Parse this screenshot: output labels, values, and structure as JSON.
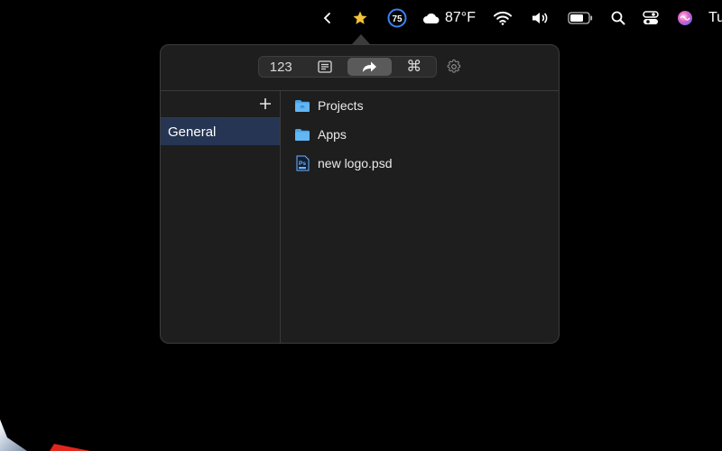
{
  "menubar": {
    "weather_temp": "87°F",
    "badge_number": "75",
    "clock_partial": "Tu",
    "icons": [
      "chevron-left-icon",
      "star-icon",
      "badge-icon",
      "cloud-icon",
      "wifi-icon",
      "volume-icon",
      "battery-icon",
      "search-icon",
      "control-center-icon",
      "siri-icon"
    ],
    "star_color": "#f5c33b",
    "badge_ring_color": "#3b82f6"
  },
  "popover": {
    "tabs": [
      {
        "label": "123",
        "icon": null
      },
      {
        "label": "",
        "icon": "notes-icon"
      },
      {
        "label": "",
        "icon": "share-arrow-icon"
      },
      {
        "label": "⌘",
        "icon": "command-icon"
      }
    ],
    "active_tab": 2,
    "sidebar": {
      "items": [
        {
          "label": "General"
        }
      ],
      "selected": 0
    },
    "files": [
      {
        "name": "Projects",
        "icon": "folder-icon"
      },
      {
        "name": "Apps",
        "icon": "folder-icon"
      },
      {
        "name": "new logo.psd",
        "icon": "psd-file-icon"
      }
    ]
  }
}
